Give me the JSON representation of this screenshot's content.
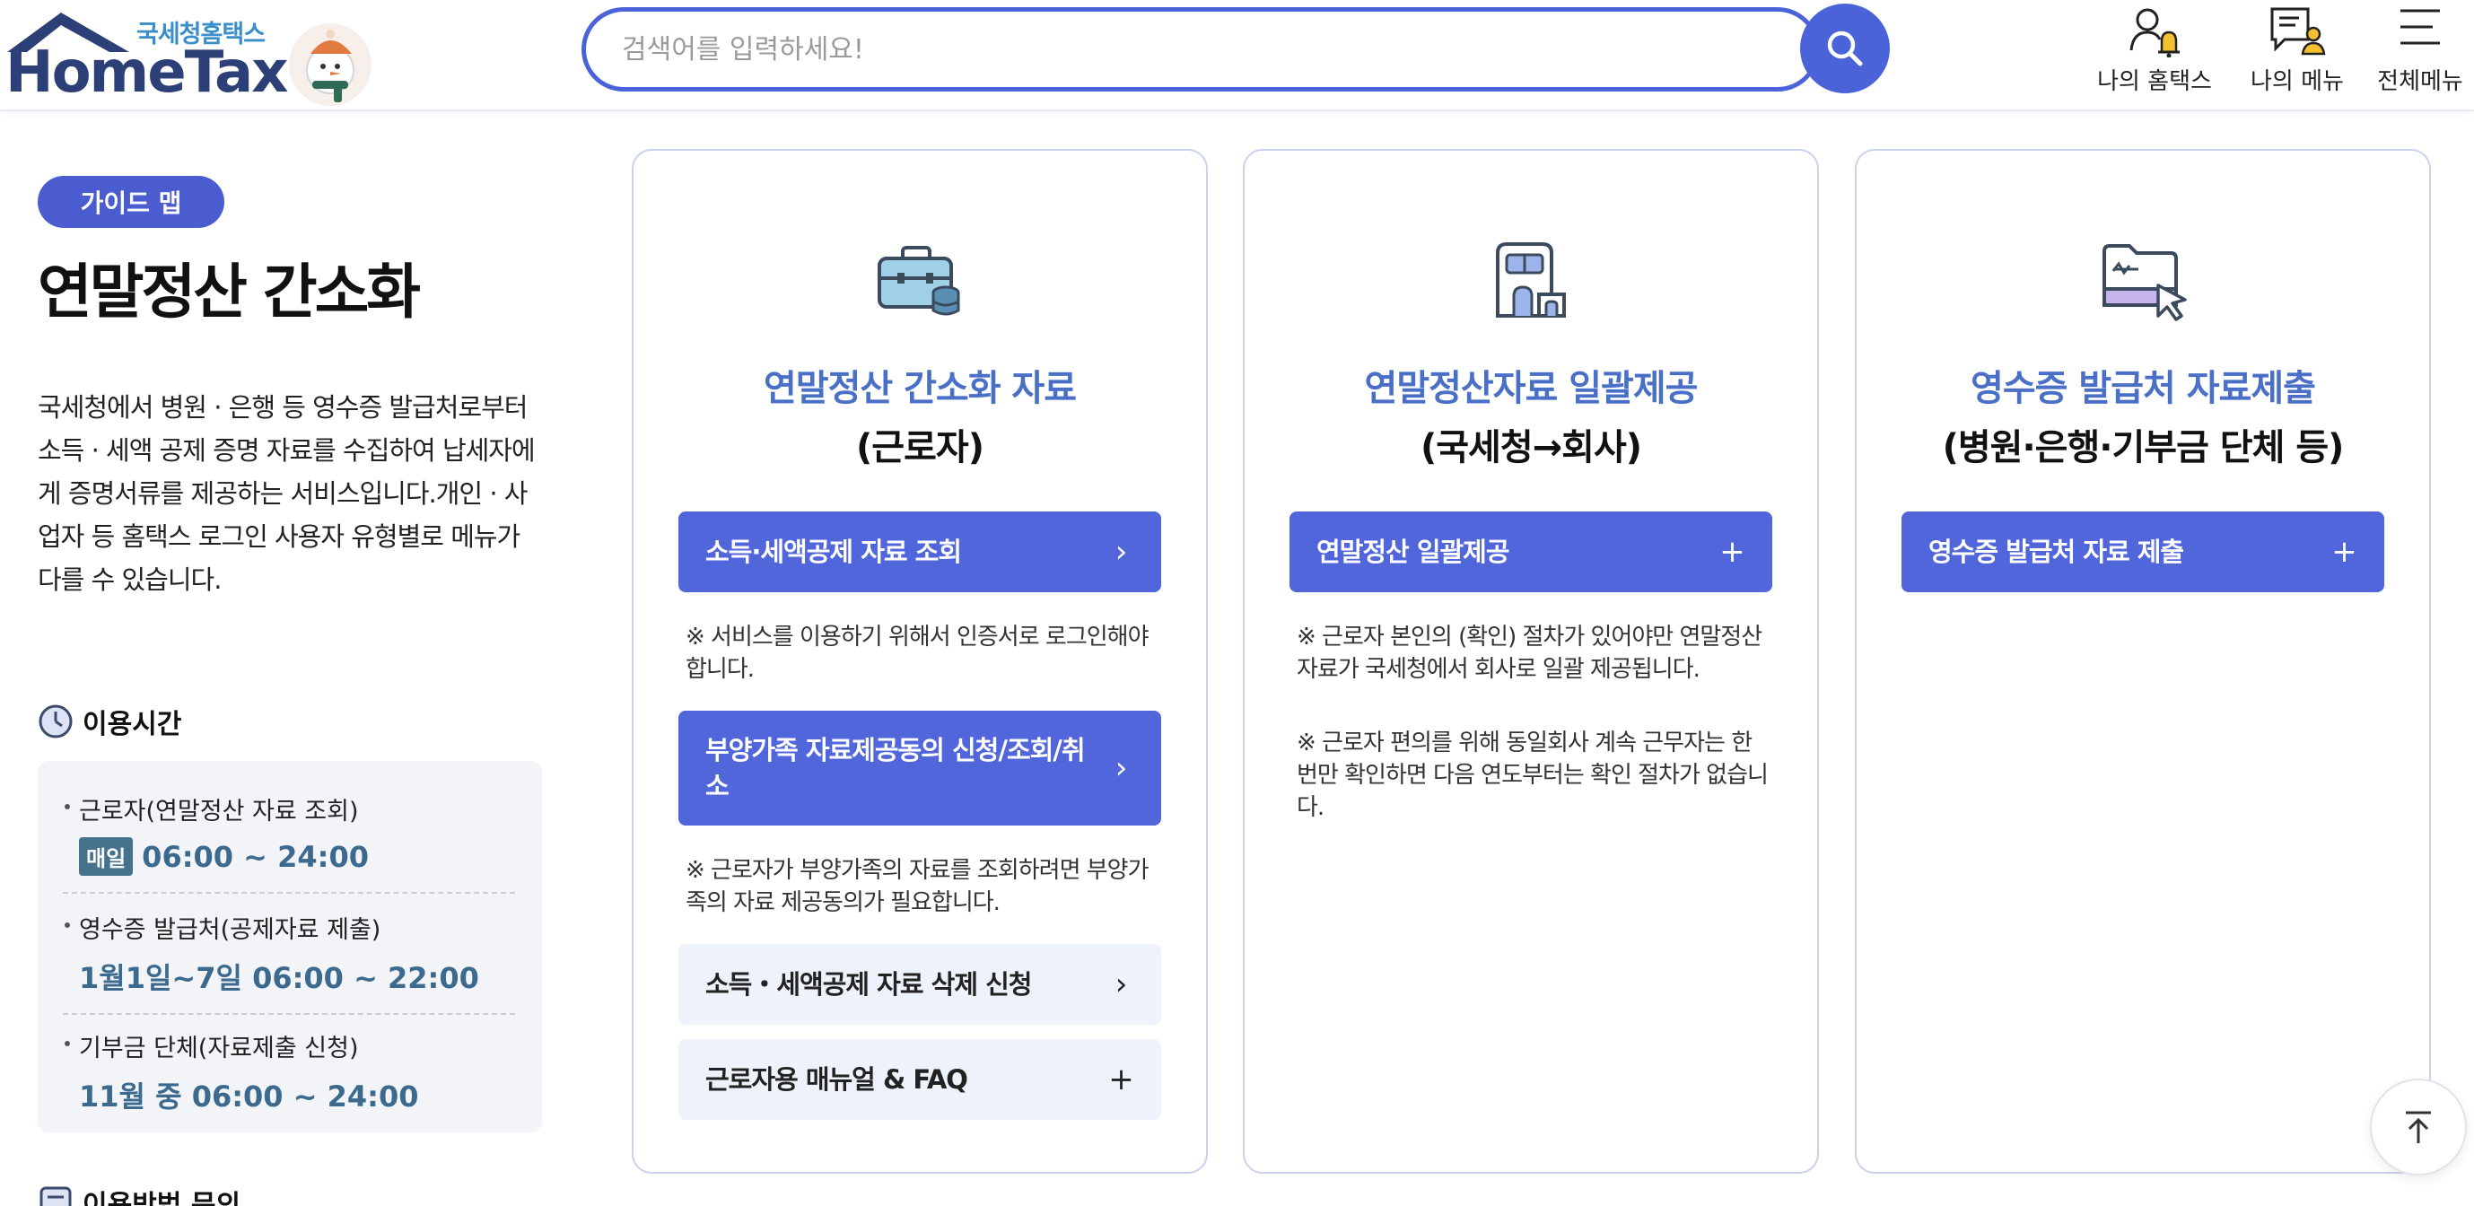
{
  "header": {
    "logo_small": "국세청홈택스",
    "logo_big": "HomeTax",
    "search_placeholder": "검색어를 입력하세요!",
    "nav": [
      {
        "label": "나의 홈택스",
        "icon": "user-bell-icon"
      },
      {
        "label": "나의 메뉴",
        "icon": "menu-user-icon"
      },
      {
        "label": "전체메뉴",
        "icon": "hamburger-icon"
      }
    ]
  },
  "left": {
    "badge": "가이드 맵",
    "title": "연말정산 간소화",
    "description": "국세청에서 병원 · 은행 등 영수증 발급처로부터 소득 · 세액 공제 증명 자료를 수집하여 납세자에게 증명서류를 제공하는 서비스입니다.개인 · 사업자 등 홈택스 로그인 사용자 유형별로 메뉴가 다를 수 있습니다.",
    "hours_title": "이용시간",
    "hours": [
      {
        "label": "근로자(연말정산 자료 조회)",
        "tag": "매일",
        "time": "06:00 ~ 24:00"
      },
      {
        "label": "영수증 발급처(공제자료 제출)",
        "time": "1월1일~7일 06:00 ~ 22:00"
      },
      {
        "label": "기부금 단체(자료제출 신청)",
        "time": "11월 중 06:00 ~ 24:00"
      }
    ],
    "usage_title": "이용방법 문의"
  },
  "cards": [
    {
      "icon": "briefcase-icon",
      "title": "연말정산 간소화 자료",
      "subtitle": "(근로자)",
      "buttons": [
        {
          "label": "소득·세액공제 자료 조회",
          "style": "primary",
          "arrow": "›"
        },
        {
          "label": "부양가족 자료제공동의 신청/조회/취소",
          "style": "primary",
          "arrow": "›"
        },
        {
          "label": "소득・세액공제 자료 삭제 신청",
          "style": "light",
          "arrow": "›"
        },
        {
          "label": "근로자용 매뉴얼 & FAQ",
          "style": "light",
          "arrow": "+"
        }
      ],
      "notes": [
        "※ 서비스를 이용하기 위해서 인증서로 로그인해야 합니다.",
        "※ 근로자가 부양가족의 자료를 조회하려면 부양가족의 자료 제공동의가 필요합니다."
      ]
    },
    {
      "icon": "building-icon",
      "title": "연말정산자료 일괄제공",
      "subtitle": "(국세청→회사)",
      "buttons": [
        {
          "label": "연말정산 일괄제공",
          "style": "primary",
          "arrow": "+"
        }
      ],
      "notes": [
        "※ 근로자 본인의 (확인) 절차가 있어야만 연말정산 자료가 국세청에서 회사로 일괄 제공됩니다.",
        "※ 근로자 편의를 위해 동일회사 계속 근무자는 한 번만 확인하면 다음 연도부터는 확인 절차가 없습니다."
      ]
    },
    {
      "icon": "folder-cursor-icon",
      "title": "영수증 발급처 자료제출",
      "subtitle": "(병원·은행·기부금 단체 등)",
      "buttons": [
        {
          "label": "영수증 발급처 자료 제출",
          "style": "primary",
          "arrow": "+"
        }
      ]
    }
  ],
  "colors": {
    "primary": "#5166db",
    "accent_blue_text": "#4a6fc7",
    "time_text": "#3b6a8e"
  }
}
